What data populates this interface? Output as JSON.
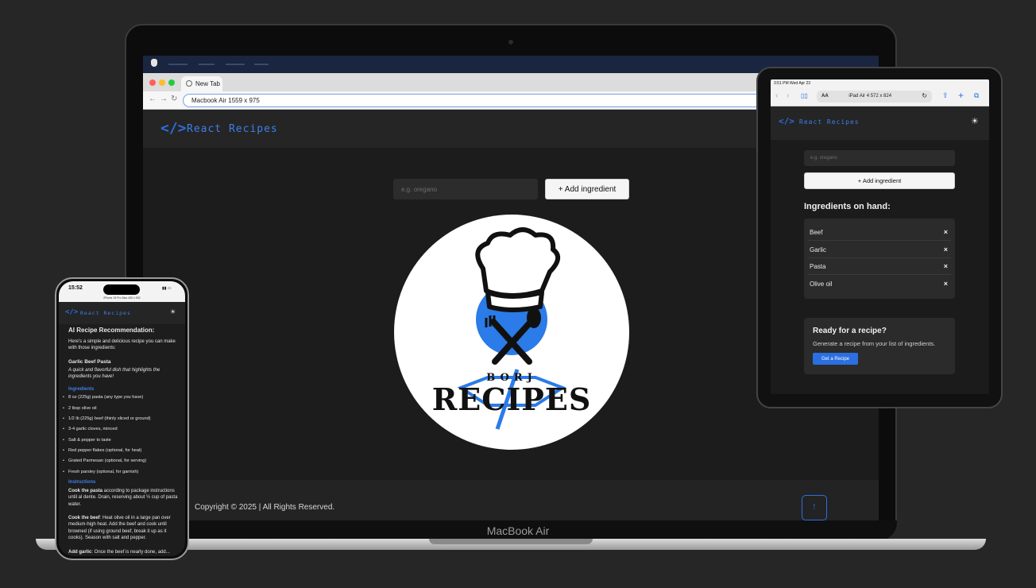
{
  "macbook": {
    "device_name": "MacBook Air",
    "browser_tab": "New Tab",
    "url_bar": "Macbook Air   1559 x 975",
    "brand": "React Recipes",
    "search_placeholder": "e.g. oregano",
    "add_button": "+ Add ingredient",
    "logo_word_small": "BORJ",
    "logo_word": "RECIPES",
    "copyright": "Copyright © 2025 | All Rights Reserved.",
    "scroll_top_icon": "arrow-up-icon"
  },
  "ipad": {
    "status_time": "3:51 PM  Wed Apr 23",
    "url_bar": "iPad Air 4   572 x 824",
    "text_size_label": "AA",
    "brand": "React Recipes",
    "search_placeholder": "e.g. oregano",
    "add_button": "+ Add ingredient",
    "ingredients_title": "Ingredients on hand:",
    "ingredients": [
      {
        "name": "Beef"
      },
      {
        "name": "Garlic"
      },
      {
        "name": "Pasta"
      },
      {
        "name": "Olive oil"
      }
    ],
    "remove_icon": "×",
    "ready_title": "Ready for a recipe?",
    "ready_sub": "Generate a recipe from your list of ingredients.",
    "get_button": "Get a Recipe"
  },
  "iphone": {
    "time": "15:52",
    "url_bar": "iPhone 15 Pro Max   430 x 932",
    "brand": "React Recipes",
    "heading": "AI Recipe Recommendation:",
    "intro": "Here's a simple and delicious recipe you can make with those ingredients:",
    "recipe_name": "Garlic Beef Pasta",
    "recipe_desc": "A quick and flavorful dish that highlights the ingredients you have!",
    "ingredients_label": "Ingredients",
    "ingredients": [
      "8 oz (225g) pasta (any type you have)",
      "2 tbsp olive oil",
      "1/2 lb (225g) beef (thinly sliced or ground)",
      "3-4 garlic cloves, minced",
      "Salt & pepper to taste",
      "Red pepper flakes (optional, for heat)",
      "Grated Parmesan (optional, for serving)",
      "Fresh parsley (optional, for garnish)"
    ],
    "instructions_label": "Instructions",
    "step1_bold": "Cook the pasta",
    "step1_text": " according to package instructions until al dente. Drain, reserving about ½ cup of pasta water.",
    "step2_bold": "Cook the beef",
    "step2_text": ": Heat olive oil in a large pan over medium-high heat. Add the beef and cook until browned (if using ground beef, break it up as it cooks). Season with salt and pepper.",
    "step3_bold": "Add garlic",
    "step3_text": ": Once the beef is nearly done, add..."
  }
}
